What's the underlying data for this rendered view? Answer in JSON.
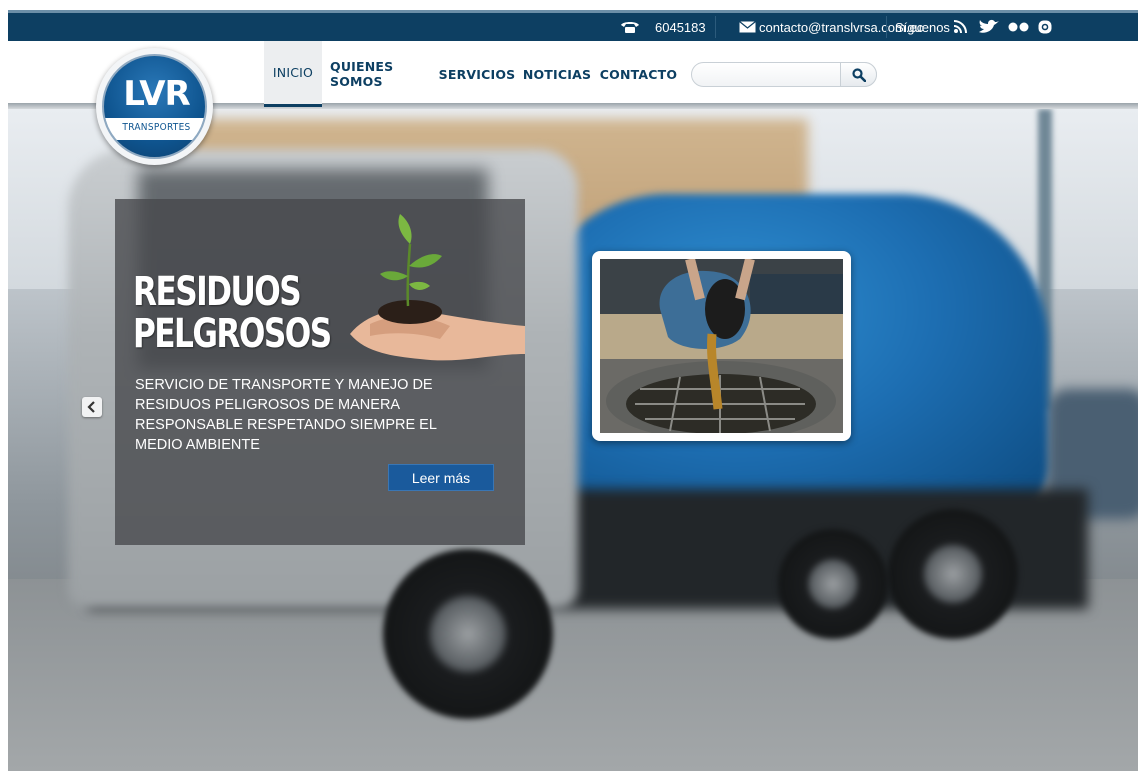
{
  "topbar": {
    "phone": "6045183",
    "email": "contacto@translvrsa.com.ec",
    "follow_label": "Síguenos",
    "social_icons": [
      "rss-icon",
      "twitter-icon",
      "flickr-icon",
      "instagram-icon"
    ]
  },
  "logo": {
    "main": "LVR",
    "sub": "TRANSPORTES"
  },
  "nav": {
    "items": [
      {
        "label": "INICIO",
        "active": true
      },
      {
        "label": "QUIENES SOMOS",
        "active": false
      },
      {
        "label": "SERVICIOS",
        "active": false
      },
      {
        "label": "NOTICIAS",
        "active": false
      },
      {
        "label": "CONTACTO",
        "active": false
      }
    ]
  },
  "search": {
    "placeholder": "",
    "value": ""
  },
  "slide": {
    "title_line1": "RESIDUOS",
    "title_line2": "PELGROSOS",
    "text_line1": "SERVICIO DE TRANSPORTE Y MANEJO DE",
    "text_line2": "RESIDUOS PELIGROSOS DE MANERA",
    "text_line3": "RESPONSABLE RESPETANDO SIEMPRE EL",
    "text_line4": "MEDIO AMBIENTE",
    "button_label": "Leer más"
  },
  "colors": {
    "brand_dark_blue": "#0d3f62",
    "button_blue": "#1a5a9c",
    "truck_blue": "#1d6eb2"
  }
}
